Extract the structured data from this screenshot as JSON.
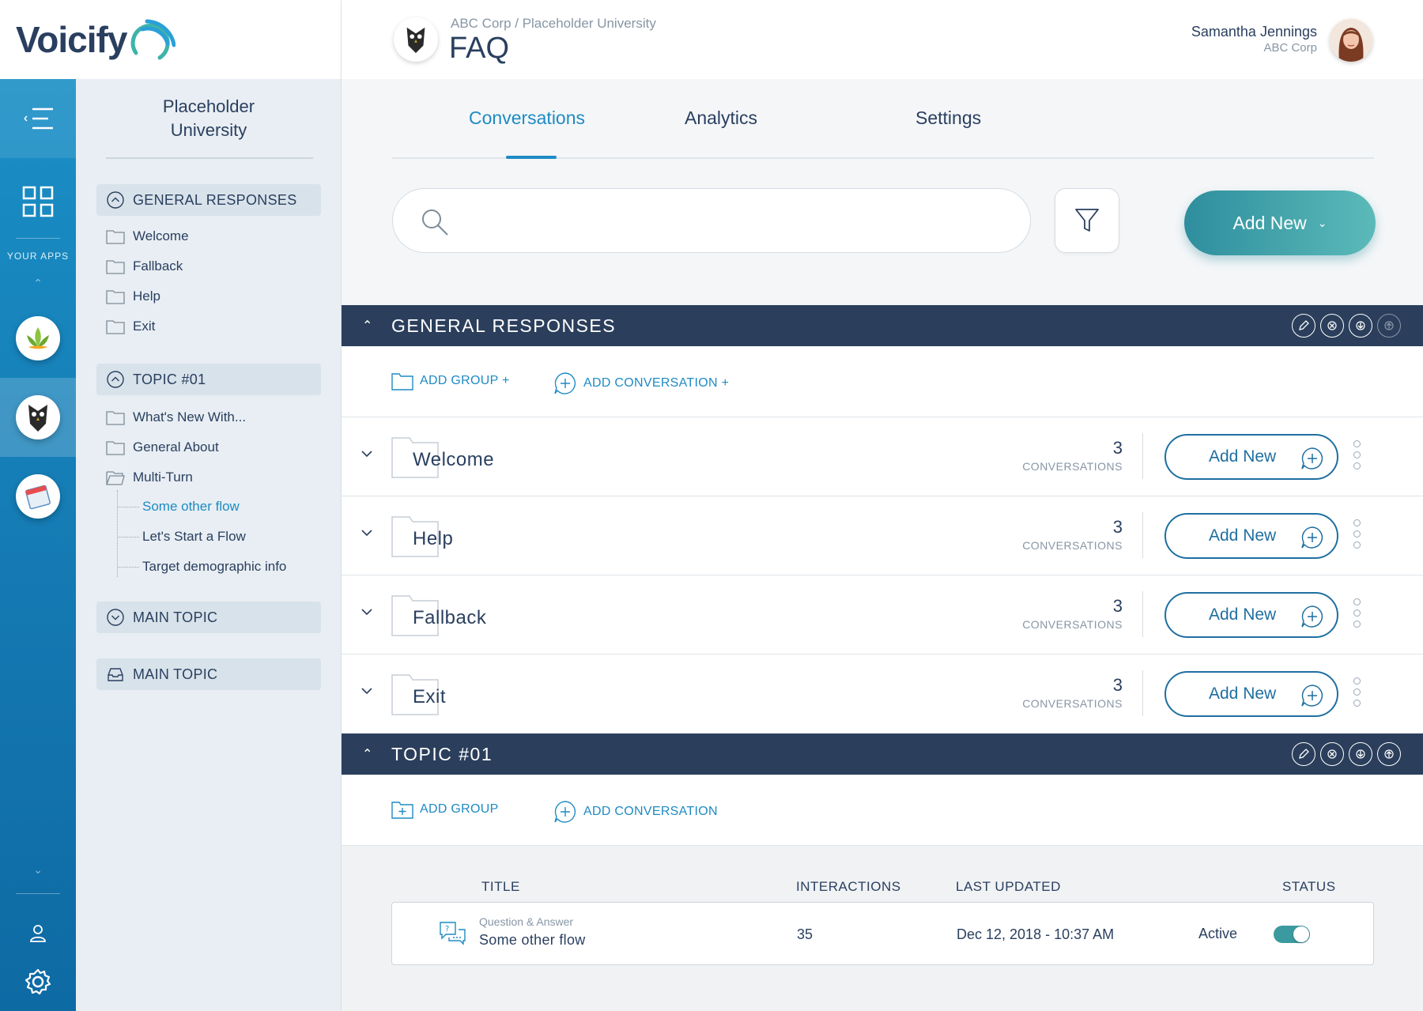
{
  "brand": {
    "name": "Voicify",
    "accent": "#1e8bc3",
    "nav_dark": "#2b3f5c",
    "teal": "#3a9aa0"
  },
  "rail": {
    "apps_label": "YOUR APPS"
  },
  "sidebar": {
    "title_line1": "Placeholder",
    "title_line2": "University",
    "groups": [
      {
        "label": "GENERAL RESPONSES",
        "items": [
          "Welcome",
          "Fallback",
          "Help",
          "Exit"
        ]
      },
      {
        "label": "TOPIC #01",
        "items": [
          "What's New With...",
          "General About",
          "Multi-Turn"
        ],
        "sub_items": [
          "Some other flow",
          "Let's Start a Flow",
          "Target demographic info"
        ]
      },
      {
        "label": "MAIN TOPIC"
      },
      {
        "label": "MAIN TOPIC"
      }
    ]
  },
  "header": {
    "breadcrumb": "ABC Corp / Placeholder University",
    "title": "FAQ",
    "user_name": "Samantha Jennings",
    "user_org": "ABC Corp"
  },
  "tabs": [
    "Conversations",
    "Analytics",
    "Settings"
  ],
  "search": {
    "placeholder": ""
  },
  "add_new_label": "Add New",
  "sections": [
    {
      "title": "GENERAL RESPONSES",
      "add_group": "ADD GROUP +",
      "add_conversation": "ADD CONVERSATION +",
      "groups": [
        {
          "name": "Welcome",
          "count": "3",
          "count_label": "CONVERSATIONS"
        },
        {
          "name": "Help",
          "count": "3",
          "count_label": "CONVERSATIONS"
        },
        {
          "name": "Fallback",
          "count": "3",
          "count_label": "CONVERSATIONS"
        },
        {
          "name": "Exit",
          "count": "3",
          "count_label": "CONVERSATIONS"
        }
      ]
    },
    {
      "title": "TOPIC #01",
      "add_group": "ADD GROUP",
      "add_conversation": "ADD CONVERSATION"
    }
  ],
  "table": {
    "columns": [
      "TITLE",
      "INTERACTIONS",
      "LAST UPDATED",
      "STATUS"
    ],
    "rows": [
      {
        "type": "Question & Answer",
        "title": "Some other flow",
        "interactions": "35",
        "last_updated": "Dec 12, 2018 - 10:37 AM",
        "status": "Active",
        "active": true
      }
    ]
  }
}
